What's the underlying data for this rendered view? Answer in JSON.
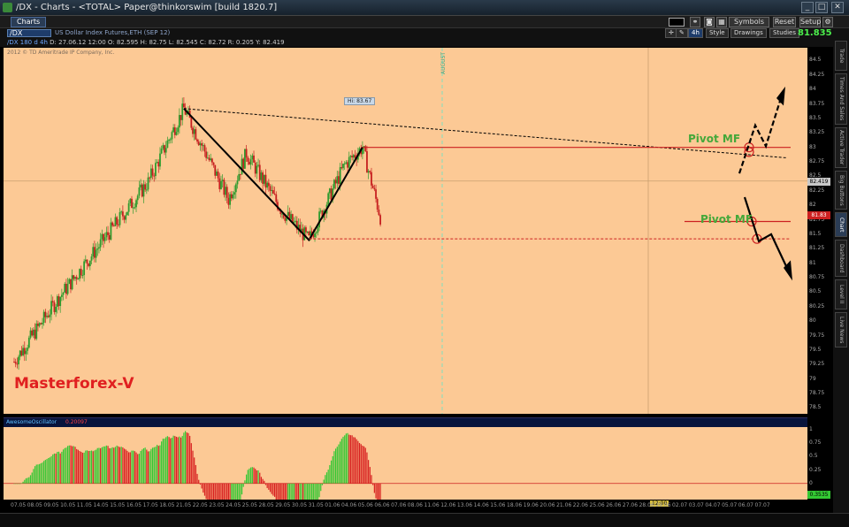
{
  "window": {
    "title": "/DX - Charts - <TOTAL> Paper@thinkorswim [build 1820.7]",
    "min": "_",
    "max": "□",
    "close": "✕"
  },
  "topbar": {
    "tab": "Charts",
    "symbols": "Symbols",
    "reset": "Reset",
    "setup": "Setup"
  },
  "chart_toolbar": {
    "symbol": "/DX",
    "description": "US Dollar Index Futures,ETH (SEP 12)",
    "aggregation": "4h",
    "style": "Style",
    "drawings": "Drawings",
    "studies": "Studies",
    "last_price": "81.835"
  },
  "ohlc": {
    "symbol": "/DX 180 d 4h",
    "values": "D: 27.06.12 12:00  O: 82.595  H: 82.75  L: 82.545  C: 82.72  R: 0.205  Y: 82.419"
  },
  "annotations": {
    "copyright": "2012 © TD Ameritrade IP Company, Inc.",
    "hi_label": "Hi: 83.67",
    "pivot_upper": "Pivot MF",
    "pivot_lower": "Pivot MF",
    "brand": "Masterforex-V",
    "event_marker": "AUGUST"
  },
  "price_axis": {
    "ticks": [
      "84.5",
      "84.25",
      "84",
      "83.75",
      "83.5",
      "83.25",
      "83",
      "82.75",
      "82.5",
      "82.25",
      "82",
      "81.75",
      "81.5",
      "81.25",
      "81",
      "80.75",
      "80.5",
      "80.25",
      "80",
      "79.75",
      "79.5",
      "79.25",
      "79",
      "78.75",
      "78.5"
    ],
    "cursor_price": "82.419",
    "last_price": "81.83"
  },
  "oscillator": {
    "name": "AwesomeOscillator",
    "value": "0.20097",
    "axis_ticks": [
      "1",
      "0.75",
      "0.5",
      "0.25",
      "0",
      "-0.25"
    ],
    "current": "0.3535"
  },
  "time_axis": {
    "labels": [
      "07.05",
      "08.05",
      "09.05",
      "10.05",
      "11.05",
      "14.05",
      "15.05",
      "16.05",
      "17.05",
      "18.05",
      "21.05",
      "22.05",
      "23.05",
      "24.05",
      "25.05",
      "28.05",
      "29.05",
      "30.05",
      "31.05",
      "01.06",
      "04.06",
      "05.06",
      "06.06",
      "07.06",
      "08.06",
      "11.06",
      "12.06",
      "13.06",
      "14.06",
      "15.06",
      "18.06",
      "19.06",
      "20.06",
      "21.06",
      "22.06",
      "25.06",
      "26.06",
      "27.06",
      "28.06",
      "29.06",
      "02.07",
      "03.07",
      "04.07",
      "05.07",
      "06.07",
      "07.07"
    ],
    "cursor_label": "12:00"
  },
  "right_tabs": [
    "Trade",
    "Times And Sales",
    "Active Trader",
    "Big Buttons",
    "Chart",
    "Dashboard",
    "Level II",
    "Live News"
  ],
  "colors": {
    "bull": "#2e9b2e",
    "bear": "#c62020",
    "chart_bg": "#fcc995",
    "pivot_line": "#cc2020"
  },
  "chart_data": {
    "type": "line",
    "title": "",
    "xlabel": "",
    "ylabel": "",
    "ylim": [
      78.4,
      84.72
    ],
    "series": [
      {
        "x": [
          "07.05",
          "14.05",
          "21.05",
          "28.05",
          "01.06",
          "08.06",
          "12.06",
          "18.06",
          "21.06",
          "27.06",
          "29.06",
          "03.07"
        ],
        "values": [
          79.3,
          80.4,
          81.4,
          82.4,
          83.67,
          82.1,
          82.9,
          81.9,
          81.4,
          82.7,
          83.0,
          81.8
        ]
      }
    ]
  }
}
